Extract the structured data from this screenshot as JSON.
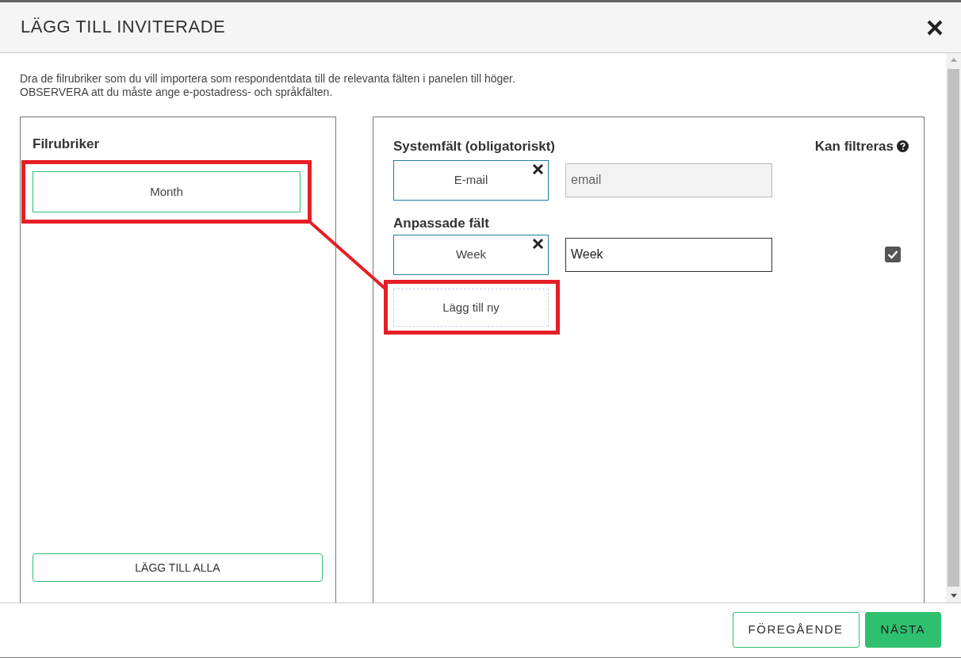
{
  "dialog": {
    "title": "LÄGG TILL INVITERADE"
  },
  "instructions": [
    "Dra de filrubriker som du vill importera som respondentdata till de relevanta fälten i panelen till höger.",
    "OBSERVERA att du måste ange e-postadress- och språkfälten."
  ],
  "file_headers": {
    "title": "Filrubriker",
    "items": [
      {
        "label": "Month",
        "highlighted": true
      }
    ],
    "add_all_button": "LÄGG TILL ALLA"
  },
  "fields_panel": {
    "system_title": "Systemfält (obligatoriskt)",
    "filter_title": "Kan filtreras",
    "system_fields": [
      {
        "header": "E-mail",
        "value": "email",
        "disabled": true
      }
    ],
    "custom_title": "Anpassade fält",
    "custom_fields": [
      {
        "header": "Week",
        "value": "Week",
        "disabled": false,
        "filterable": true
      }
    ],
    "add_new": {
      "label": "Lägg till ny",
      "highlighted": true
    }
  },
  "footer": {
    "buttons": [
      {
        "label": "FÖREGÅENDE",
        "kind": "outline"
      },
      {
        "label": "NÄSTA",
        "kind": "primary"
      }
    ]
  }
}
